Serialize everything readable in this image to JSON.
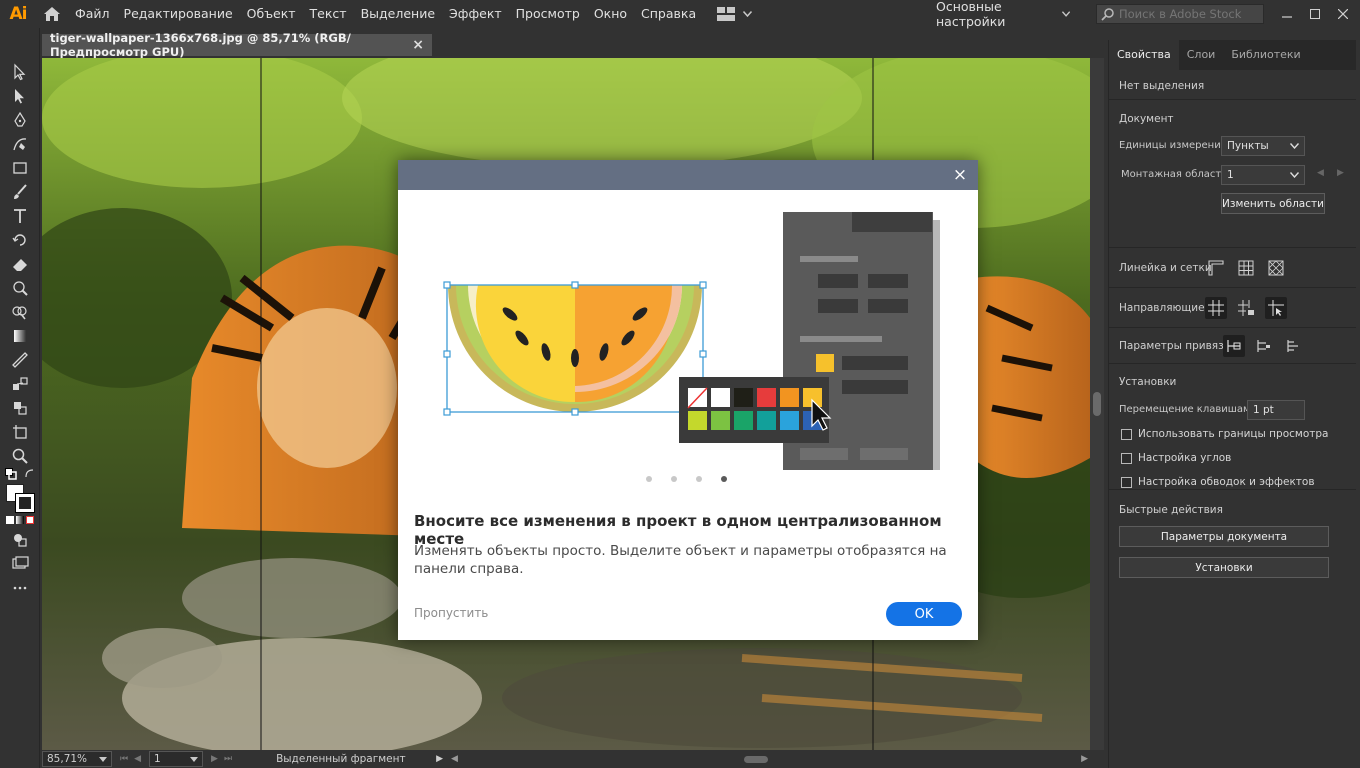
{
  "app": {
    "logo": "Ai"
  },
  "menu": [
    "Файл",
    "Редактирование",
    "Объект",
    "Текст",
    "Выделение",
    "Эффект",
    "Просмотр",
    "Окно",
    "Справка"
  ],
  "workspace": {
    "label": "Основные настройки"
  },
  "search": {
    "placeholder": "Поиск в Adobe Stock"
  },
  "document_tab": {
    "title": "tiger-wallpaper-1366x768.jpg @ 85,71% (RGB/Предпросмотр GPU)",
    "close": "×"
  },
  "status": {
    "zoom": "85,71%",
    "page": "1",
    "selection_label": "Выделенный фрагмент"
  },
  "dialog": {
    "close": "×",
    "title": "Вносите все изменения в проект в одном централизованном месте",
    "body": "Изменять объекты просто. Выделите объект и параметры отобразятся на панели справа.",
    "skip": "Пропустить",
    "ok": "OK",
    "pages": 4,
    "active_page": 4,
    "swatches_row1": [
      "#ffffff",
      "#ffffff",
      "#1f1f17",
      "#e63c3c",
      "#f29420",
      "#f7c02c"
    ],
    "swatches_row2": [
      "#c4d82c",
      "#7cc242",
      "#1aa468",
      "#12a09a",
      "#2aa3dc",
      "#2c62b4"
    ]
  },
  "panel": {
    "tabs": [
      "Свойства",
      "Слои",
      "Библиотеки"
    ],
    "no_selection": "Нет выделения",
    "document": {
      "heading": "Документ",
      "units_label": "Единицы измерения:",
      "units_value": "Пункты",
      "artboard_label": "Монтажная область:",
      "artboard_value": "1",
      "edit_artboards": "Изменить области"
    },
    "rulers_label": "Линейка и сетки",
    "guides_label": "Направляющие",
    "snap_label": "Параметры привязки",
    "prefs": {
      "heading": "Установки",
      "nudge_label": "Перемещение клавишами:",
      "nudge_value": "1 pt",
      "chk1": "Использовать границы просмотра",
      "chk2": "Настройка углов",
      "chk3": "Настройка обводок и эффектов"
    },
    "quick": {
      "heading": "Быстрые действия",
      "doc_setup": "Параметры документа",
      "preferences": "Установки"
    }
  }
}
